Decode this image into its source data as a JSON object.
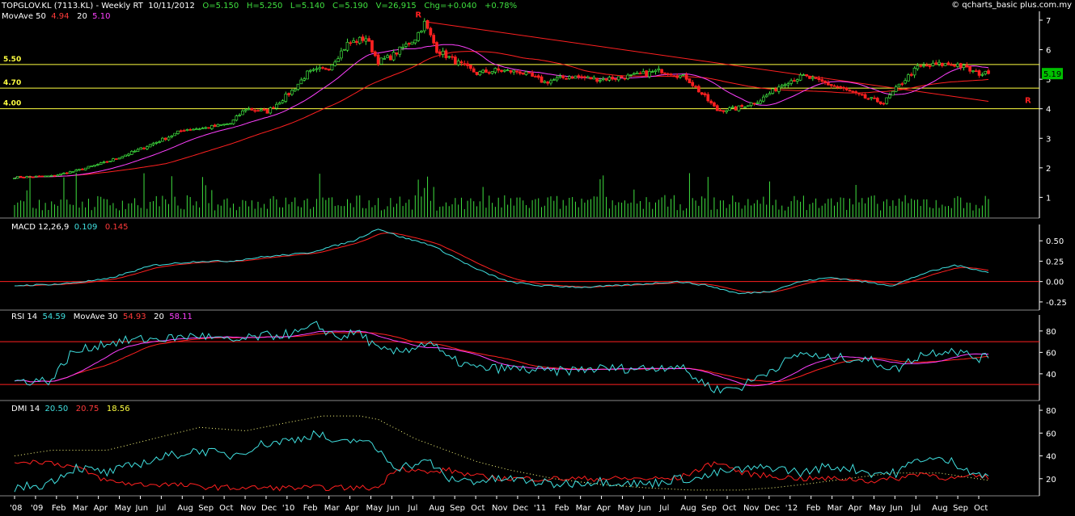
{
  "header": {
    "symbol": "TOPGLOV.KL (7113.KL) - Weekly RT",
    "date": "10/11/2012",
    "open": "O=5.150",
    "high": "H=5.250",
    "low": "L=5.140",
    "close": "C=5.190",
    "volume": "V=26,915",
    "change": "Chg=+0.040",
    "change_pct": "+0.78%",
    "copyright": "© qcharts_basic plus.com.my"
  },
  "indicator_labels": {
    "price_ma": {
      "label": "MovAve 50",
      "v1": "4.94",
      "p2": "20",
      "v2": "5.10"
    },
    "macd": {
      "label": "MACD 12,26,9",
      "v1": "0.109",
      "v2": "0.145"
    },
    "rsi": {
      "label": "RSI 14",
      "v1": "54.59",
      "ma": "MovAve 30",
      "v2": "54.93",
      "p3": "20",
      "v3": "58.11"
    },
    "dmi": {
      "label": "DMI 14",
      "v1": "20.50",
      "v2": "20.75",
      "v3": "18.56"
    }
  },
  "colors": {
    "bull": "#3fe03f",
    "bear": "#ff2020",
    "ma50": "#ff2020",
    "ma20": "#ff40ff",
    "cyan": "#40e0e0",
    "hline_yellow": "#ffff40",
    "hline_red": "#ff2020",
    "trend": "#ff2020",
    "axis": "#ffffff",
    "volume": "#3fe03f",
    "last_box": "#00c000"
  },
  "chart_data": {
    "type": "candlestick",
    "title": "TOPGLOV.KL (7113.KL) - Weekly RT",
    "x_tick_labels": [
      "'08",
      "'09",
      "Feb",
      "Mar",
      "Apr",
      "May",
      "Jun",
      "Jul",
      "Aug",
      "Sep",
      "Oct",
      "Nov",
      "Dec",
      "'10",
      "Feb",
      "Mar",
      "Apr",
      "May",
      "Jun",
      "Jul",
      "Aug",
      "Sep",
      "Oct",
      "Nov",
      "Dec",
      "'11",
      "Feb",
      "Mar",
      "Apr",
      "May",
      "Jun",
      "Jul",
      "Aug",
      "Sep",
      "Oct",
      "Nov",
      "Dec",
      "'12",
      "Feb",
      "Mar",
      "Apr",
      "May",
      "Jun",
      "Jul",
      "Aug",
      "Sep",
      "Oct"
    ],
    "price_ticks": [
      "1",
      "2",
      "3",
      "4",
      "5",
      "6",
      "7"
    ],
    "price_range": [
      0.3,
      7.3
    ],
    "levels": [
      {
        "value": 5.5,
        "label": "5.50"
      },
      {
        "value": 4.7,
        "label": "4.70"
      },
      {
        "value": 4.0,
        "label": "4.00"
      }
    ],
    "resistance_markers": [
      "R",
      "R"
    ],
    "last_price_label": "5.19",
    "price_anchors": [
      [
        0,
        1.68
      ],
      [
        12,
        1.72
      ],
      [
        20,
        1.9
      ],
      [
        30,
        2.2
      ],
      [
        40,
        2.6
      ],
      [
        50,
        3.05
      ],
      [
        55,
        3.3
      ],
      [
        62,
        3.35
      ],
      [
        70,
        3.5
      ],
      [
        75,
        4.0
      ],
      [
        82,
        3.9
      ],
      [
        90,
        4.6
      ],
      [
        95,
        5.2
      ],
      [
        102,
        5.4
      ],
      [
        108,
        6.2
      ],
      [
        114,
        6.4
      ],
      [
        118,
        5.6
      ],
      [
        122,
        5.75
      ],
      [
        130,
        6.4
      ],
      [
        133,
        6.9
      ],
      [
        137,
        6.0
      ],
      [
        143,
        5.6
      ],
      [
        150,
        5.2
      ],
      [
        156,
        5.3
      ],
      [
        164,
        5.25
      ],
      [
        172,
        4.9
      ],
      [
        180,
        5.1
      ],
      [
        190,
        5.0
      ],
      [
        200,
        5.1
      ],
      [
        210,
        5.3
      ],
      [
        218,
        5.05
      ],
      [
        223,
        4.5
      ],
      [
        228,
        3.95
      ],
      [
        234,
        4.0
      ],
      [
        242,
        4.3
      ],
      [
        250,
        4.9
      ],
      [
        256,
        5.1
      ],
      [
        262,
        4.9
      ],
      [
        268,
        4.7
      ],
      [
        275,
        4.4
      ],
      [
        282,
        4.2
      ],
      [
        288,
        4.9
      ],
      [
        293,
        5.4
      ],
      [
        300,
        5.5
      ],
      [
        306,
        5.5
      ],
      [
        312,
        5.2
      ],
      [
        316,
        5.19
      ]
    ],
    "volume_range": [
      0,
      1.0
    ],
    "macd_ticks": [
      "0.50",
      "0.25",
      "0.00",
      "-0.25"
    ],
    "macd_range": [
      -0.35,
      0.7
    ],
    "macd_anchors": [
      [
        0,
        -0.05
      ],
      [
        15,
        -0.03
      ],
      [
        30,
        0.03
      ],
      [
        45,
        0.2
      ],
      [
        60,
        0.25
      ],
      [
        70,
        0.25
      ],
      [
        80,
        0.3
      ],
      [
        95,
        0.35
      ],
      [
        110,
        0.5
      ],
      [
        118,
        0.65
      ],
      [
        125,
        0.55
      ],
      [
        135,
        0.45
      ],
      [
        140,
        0.35
      ],
      [
        150,
        0.15
      ],
      [
        160,
        0.0
      ],
      [
        170,
        -0.05
      ],
      [
        185,
        -0.07
      ],
      [
        200,
        -0.04
      ],
      [
        215,
        0.0
      ],
      [
        225,
        -0.05
      ],
      [
        235,
        -0.15
      ],
      [
        245,
        -0.12
      ],
      [
        255,
        0.0
      ],
      [
        265,
        0.05
      ],
      [
        275,
        0.0
      ],
      [
        285,
        -0.05
      ],
      [
        295,
        0.1
      ],
      [
        305,
        0.2
      ],
      [
        312,
        0.15
      ],
      [
        316,
        0.109
      ]
    ],
    "rsi_ticks": [
      "80",
      "60",
      "40"
    ],
    "rsi_range": [
      15,
      95
    ],
    "rsi_levels": [
      70,
      30
    ],
    "rsi_anchors": [
      [
        0,
        33
      ],
      [
        12,
        34
      ],
      [
        18,
        58
      ],
      [
        28,
        68
      ],
      [
        40,
        72
      ],
      [
        50,
        73
      ],
      [
        60,
        76
      ],
      [
        70,
        70
      ],
      [
        80,
        75
      ],
      [
        92,
        78
      ],
      [
        98,
        85
      ],
      [
        105,
        74
      ],
      [
        112,
        79
      ],
      [
        118,
        62
      ],
      [
        124,
        60
      ],
      [
        135,
        70
      ],
      [
        140,
        55
      ],
      [
        150,
        45
      ],
      [
        160,
        45
      ],
      [
        175,
        42
      ],
      [
        190,
        45
      ],
      [
        205,
        45
      ],
      [
        215,
        48
      ],
      [
        222,
        34
      ],
      [
        228,
        25
      ],
      [
        236,
        28
      ],
      [
        246,
        45
      ],
      [
        256,
        60
      ],
      [
        262,
        54
      ],
      [
        270,
        55
      ],
      [
        278,
        52
      ],
      [
        286,
        44
      ],
      [
        294,
        58
      ],
      [
        304,
        63
      ],
      [
        312,
        55
      ],
      [
        316,
        54.59
      ]
    ],
    "dmi_ticks": [
      "80",
      "60",
      "40",
      "20"
    ],
    "dmi_range": [
      5,
      85
    ],
    "dmi_plus_anchors": [
      [
        0,
        12
      ],
      [
        10,
        15
      ],
      [
        20,
        30
      ],
      [
        30,
        25
      ],
      [
        40,
        33
      ],
      [
        50,
        40
      ],
      [
        60,
        45
      ],
      [
        70,
        40
      ],
      [
        80,
        50
      ],
      [
        92,
        55
      ],
      [
        98,
        60
      ],
      [
        105,
        50
      ],
      [
        112,
        55
      ],
      [
        118,
        45
      ],
      [
        124,
        30
      ],
      [
        135,
        35
      ],
      [
        140,
        20
      ],
      [
        150,
        18
      ],
      [
        160,
        20
      ],
      [
        175,
        15
      ],
      [
        190,
        18
      ],
      [
        205,
        15
      ],
      [
        215,
        20
      ],
      [
        222,
        20
      ],
      [
        228,
        25
      ],
      [
        236,
        28
      ],
      [
        246,
        30
      ],
      [
        256,
        25
      ],
      [
        262,
        30
      ],
      [
        270,
        30
      ],
      [
        278,
        25
      ],
      [
        286,
        25
      ],
      [
        294,
        38
      ],
      [
        304,
        35
      ],
      [
        312,
        25
      ],
      [
        316,
        20.5
      ]
    ],
    "dmi_minus_anchors": [
      [
        0,
        35
      ],
      [
        10,
        35
      ],
      [
        20,
        30
      ],
      [
        30,
        18
      ],
      [
        40,
        15
      ],
      [
        50,
        15
      ],
      [
        60,
        13
      ],
      [
        70,
        12
      ],
      [
        80,
        12
      ],
      [
        92,
        12
      ],
      [
        98,
        12
      ],
      [
        105,
        12
      ],
      [
        112,
        12
      ],
      [
        118,
        12
      ],
      [
        124,
        30
      ],
      [
        135,
        25
      ],
      [
        140,
        28
      ],
      [
        150,
        22
      ],
      [
        160,
        20
      ],
      [
        175,
        20
      ],
      [
        190,
        20
      ],
      [
        205,
        20
      ],
      [
        215,
        20
      ],
      [
        222,
        28
      ],
      [
        228,
        35
      ],
      [
        236,
        25
      ],
      [
        246,
        22
      ],
      [
        256,
        20
      ],
      [
        262,
        20
      ],
      [
        270,
        20
      ],
      [
        278,
        18
      ],
      [
        286,
        20
      ],
      [
        294,
        25
      ],
      [
        304,
        20
      ],
      [
        312,
        22
      ],
      [
        316,
        20.75
      ]
    ],
    "adx_anchors": [
      [
        0,
        40
      ],
      [
        12,
        45
      ],
      [
        30,
        45
      ],
      [
        45,
        55
      ],
      [
        60,
        65
      ],
      [
        75,
        62
      ],
      [
        90,
        70
      ],
      [
        100,
        75
      ],
      [
        112,
        75
      ],
      [
        118,
        72
      ],
      [
        130,
        55
      ],
      [
        140,
        45
      ],
      [
        150,
        35
      ],
      [
        160,
        28
      ],
      [
        175,
        20
      ],
      [
        190,
        15
      ],
      [
        205,
        12
      ],
      [
        220,
        10
      ],
      [
        235,
        10
      ],
      [
        246,
        12
      ],
      [
        256,
        15
      ],
      [
        270,
        20
      ],
      [
        285,
        25
      ],
      [
        300,
        25
      ],
      [
        316,
        18.56
      ]
    ]
  }
}
